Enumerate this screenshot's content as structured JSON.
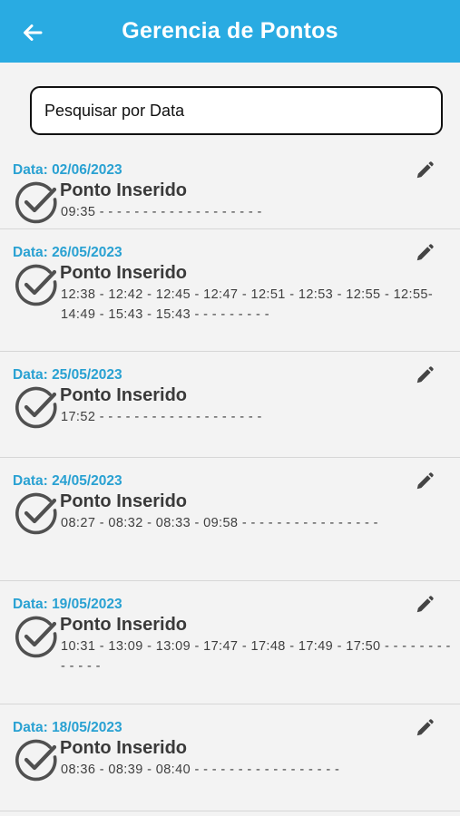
{
  "header": {
    "title": "Gerencia de Pontos",
    "back_icon": "arrow-left-icon"
  },
  "search": {
    "placeholder": "Pesquisar por Data"
  },
  "colors": {
    "accent": "#29abe2",
    "date_text": "#29a1d2",
    "background": "#f3f3f3"
  },
  "records": [
    {
      "date": "Data: 02/06/2023",
      "status": "Ponto Inserido",
      "times": "09:35 - - - - - - - - - - - - - - - - - - -"
    },
    {
      "date": "Data: 26/05/2023",
      "status": "Ponto Inserido",
      "times": "12:38 - 12:42 - 12:45 - 12:47 - 12:51 - 12:53 - 12:55 - 12:55- 14:49 - 15:43 - 15:43 - - - - - - - - -"
    },
    {
      "date": "Data: 25/05/2023",
      "status": "Ponto Inserido",
      "times": "17:52 - - - - - - - - - - - - - - - - - - -"
    },
    {
      "date": "Data: 24/05/2023",
      "status": "Ponto Inserido",
      "times": "08:27 - 08:32 - 08:33 - 09:58 - - - - - - - - - - - - - - - -"
    },
    {
      "date": "Data: 19/05/2023",
      "status": "Ponto Inserido",
      "times": "10:31 - 13:09 - 13:09 - 17:47 - 17:48 - 17:49 - 17:50 - - - - - - - - - - - - -"
    },
    {
      "date": "Data: 18/05/2023",
      "status": "Ponto Inserido",
      "times": "08:36 - 08:39 - 08:40 - - - - - - - - - - - - - - - - -"
    }
  ]
}
